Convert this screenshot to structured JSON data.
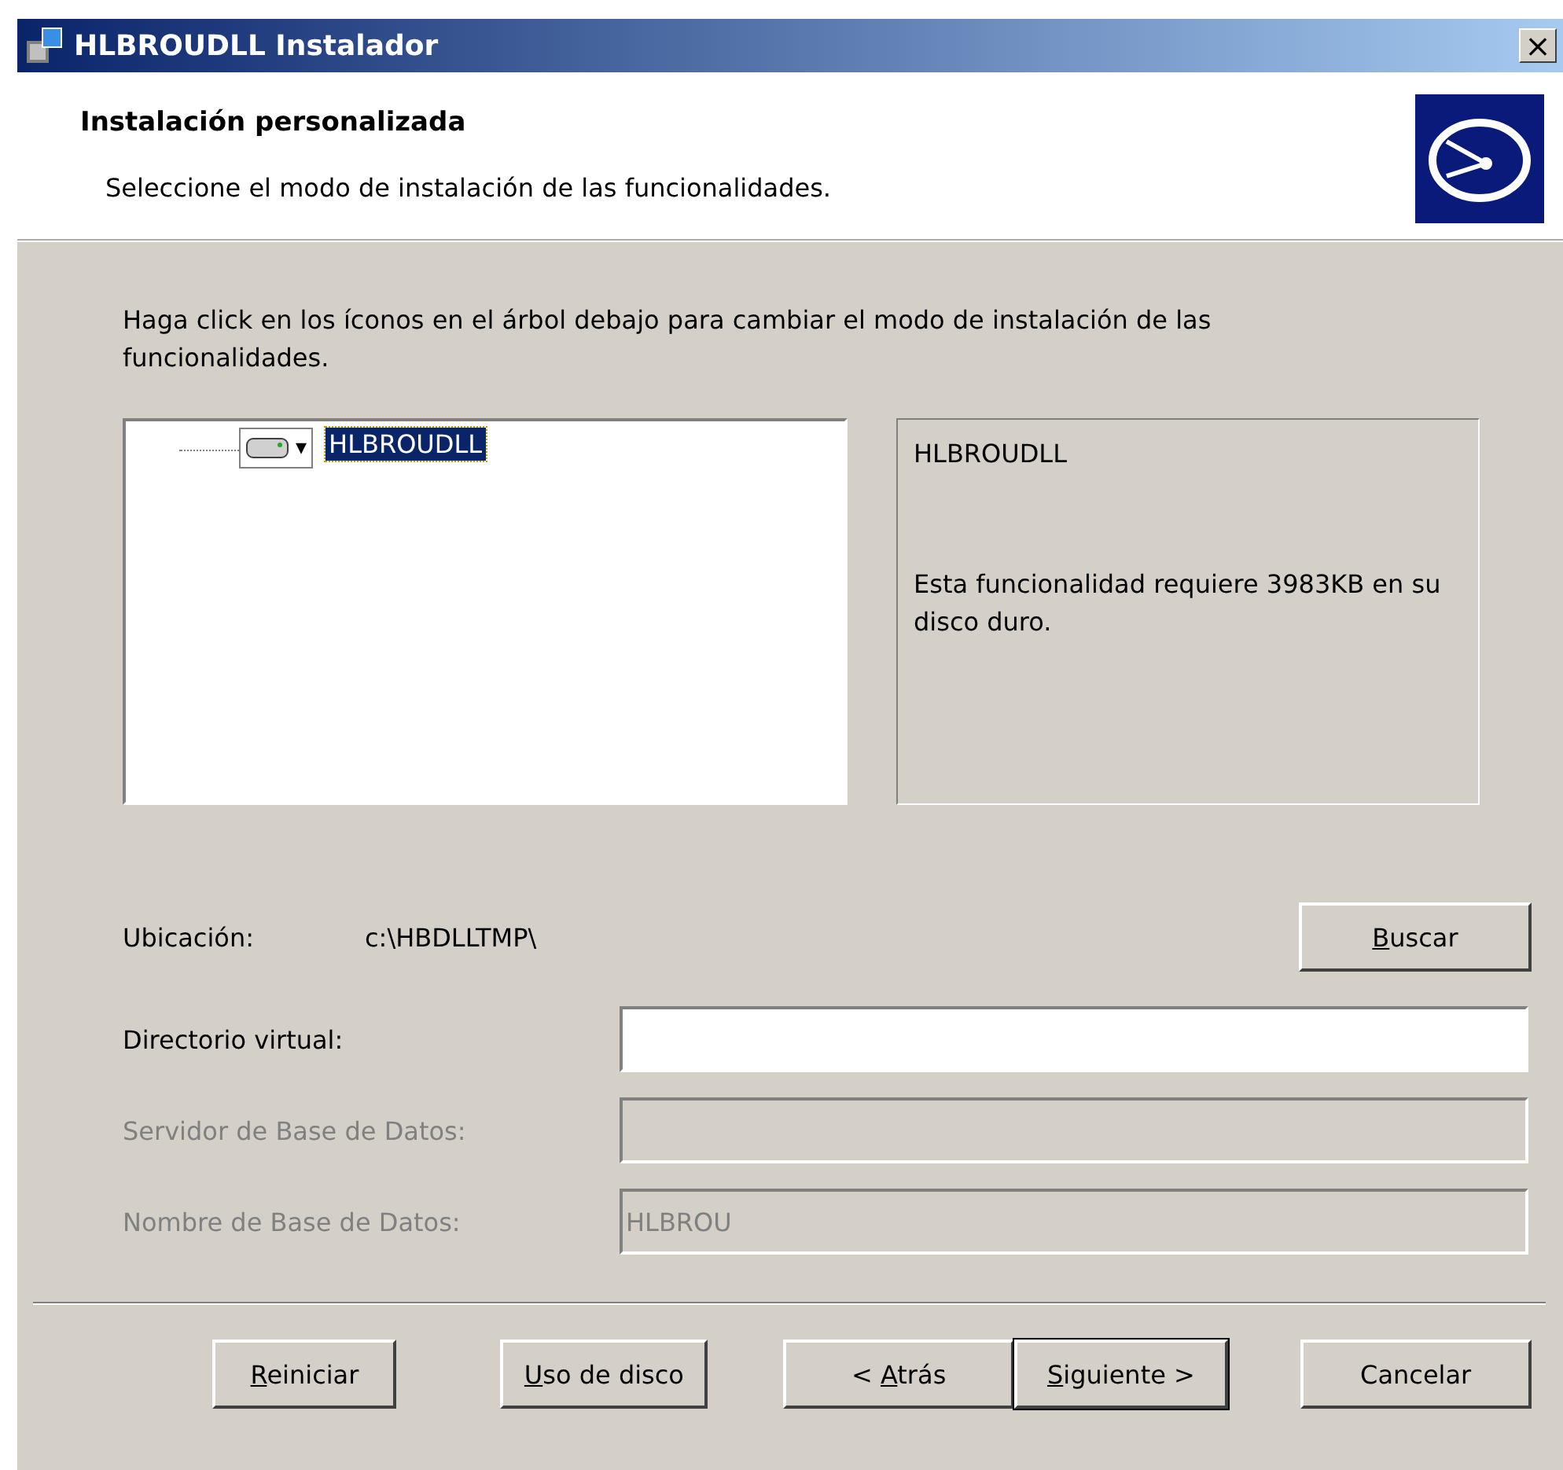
{
  "window": {
    "title": "HLBROUDLL Instalador",
    "close": "×"
  },
  "header": {
    "title": "Instalación personalizada",
    "subtitle": "Seleccione el modo de instalación de las funcionalidades."
  },
  "instructions": "Haga click en los íconos en el árbol debajo para cambiar el modo de instalación de las funcionalidades.",
  "tree": {
    "items": [
      {
        "label": "HLBROUDLL",
        "selected": true,
        "dropdown": "▾"
      }
    ]
  },
  "info": {
    "title": "HLBROUDLL",
    "description": "Esta funcionalidad requiere 3983KB en su disco duro."
  },
  "location": {
    "label": "Ubicación:",
    "value": "c:\\HBDLLTMP\\",
    "button": {
      "label": "Buscar",
      "mnemonic": true
    }
  },
  "fields": [
    {
      "label": "Directorio virtual:",
      "disabled": false
    },
    {
      "label": "Servidor de Base de Datos:",
      "disabled": true
    },
    {
      "label": "Nombre de Base de Datos:",
      "value": "HLBROU",
      "disabled": true
    }
  ],
  "buttons": [
    {
      "label": "Reiniciar",
      "mnemonic": true,
      "default": false
    },
    {
      "label": "Uso de disco",
      "mnemonic": true,
      "default": false
    },
    {
      "label": "< Atrás",
      "mnemonic": true,
      "default": false
    },
    {
      "label": "Siguiente >",
      "mnemonic": true,
      "default": true
    },
    {
      "label": "Cancelar",
      "mnemonic": false,
      "default": false
    }
  ]
}
